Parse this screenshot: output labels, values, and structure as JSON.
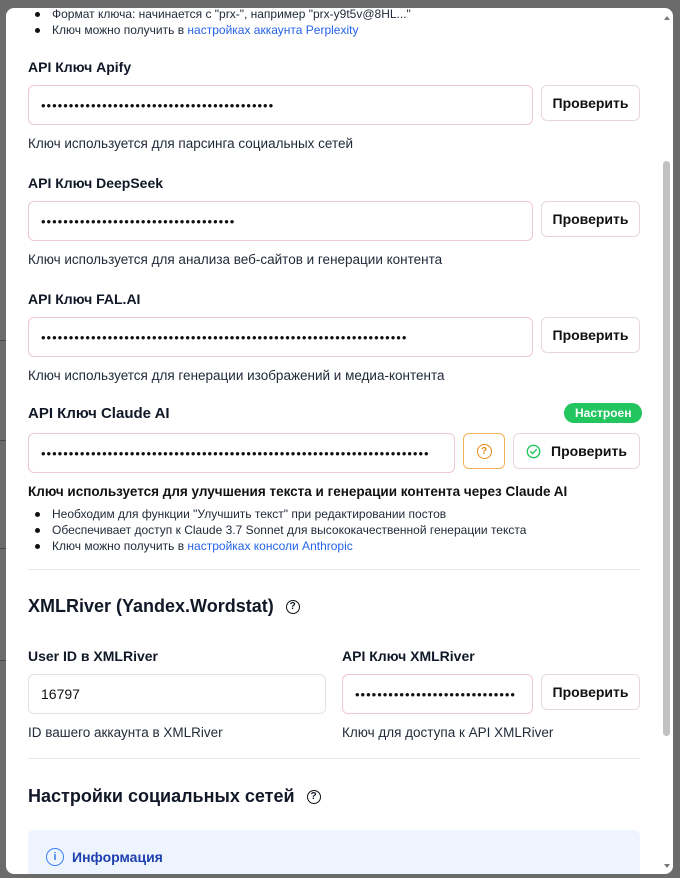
{
  "perplexity": {
    "notes": [
      {
        "text": "Формат ключа: начинается с \"prx-\", например \"prx-y9t5v@8HL...\""
      },
      {
        "text": "Ключ можно получить в ",
        "link": "настройках аккаунта Perplexity"
      }
    ]
  },
  "apify": {
    "label": "API Ключ Apify",
    "value": "••••••••••••••••••••••••••••••••••••••••••",
    "check_label": "Проверить",
    "hint": "Ключ используется для парсинга социальных сетей"
  },
  "deepseek": {
    "label": "API Ключ DeepSeek",
    "value": "•••••••••••••••••••••••••••••••••••",
    "check_label": "Проверить",
    "hint": "Ключ используется для анализа веб-сайтов и генерации контента"
  },
  "falai": {
    "label": "API Ключ FAL.AI",
    "value": "••••••••••••••••••••••••••••••••••••••••••••••••••••••••••••••••••",
    "check_label": "Проверить",
    "hint": "Ключ используется для генерации изображений и медиа-контента"
  },
  "claude": {
    "label": "API Ключ Claude AI",
    "status_badge": "Настроен",
    "status_color": "#22c55e",
    "value": "••••••••••••••••••••••••••••••••••••••••••••••••••••••••••••••••••••••",
    "check_label": "Проверить",
    "hint": "Ключ используется для улучшения текста и генерации контента через Claude AI",
    "notes": [
      {
        "text": "Необходим для функции \"Улучшить текст\" при редактировании постов"
      },
      {
        "text": "Обеспечивает доступ к Claude 3.7 Sonnet для высококачественной генерации текста"
      },
      {
        "text": "Ключ можно получить в ",
        "link": "настройках консоли Anthropic"
      }
    ]
  },
  "xmlriver": {
    "section_title": "XMLRiver (Yandex.Wordstat)",
    "user_id_label": "User ID в XMLRiver",
    "user_id_value": "16797",
    "user_id_hint": "ID вашего аккаунта в XMLRiver",
    "api_label": "API Ключ XMLRiver",
    "api_value": "•••••••••••••••••••••••••••••",
    "check_label": "Проверить",
    "api_hint": "Ключ для доступа к API XMLRiver"
  },
  "social": {
    "section_title": "Настройки социальных сетей",
    "info_title": "Информация"
  },
  "colors": {
    "accent_link": "#2563eb",
    "input_border": "#f0c8cf",
    "info_bg": "#eef4fd",
    "warning_border": "#f0b35a"
  }
}
